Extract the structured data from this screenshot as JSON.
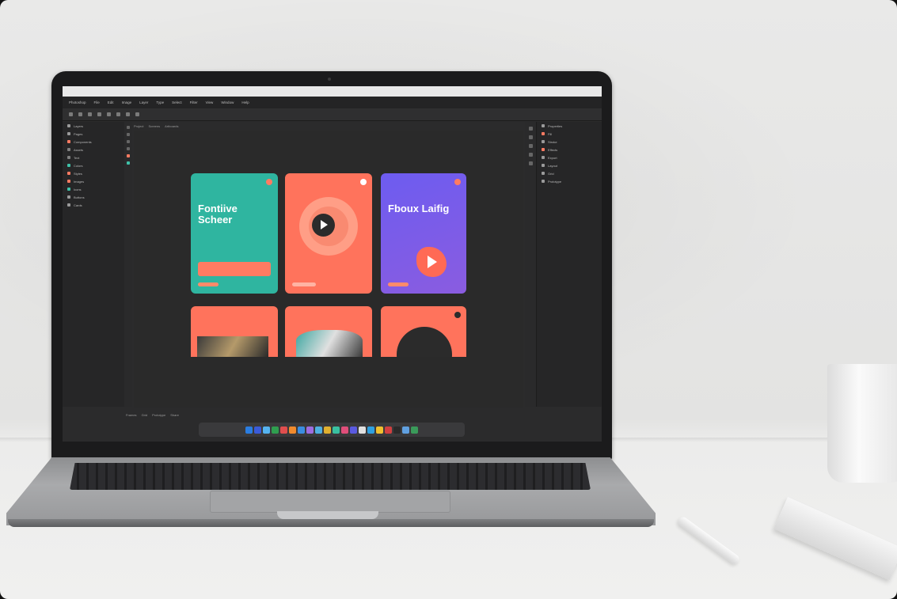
{
  "colors": {
    "teal": "#2fb5a0",
    "coral": "#ff735c",
    "purple": "#6d5cf0",
    "dark_ui": "#2b2b2c",
    "wall": "#e6e6e5"
  },
  "app": {
    "menu": [
      "Photoshop",
      "File",
      "Edit",
      "Image",
      "Layer",
      "Type",
      "Select",
      "Filter",
      "View",
      "Window",
      "Help"
    ],
    "breadcrumb": [
      "Project",
      "Screens",
      "Artboards"
    ],
    "status": [
      "Frames",
      "Grid",
      "Prototype",
      "Share"
    ]
  },
  "left_panel": {
    "items": [
      {
        "label": "Layers",
        "color": "#9a9a9a"
      },
      {
        "label": "Pages",
        "color": "#9a9a9a"
      },
      {
        "label": "Components",
        "color": "#ff7b62"
      },
      {
        "label": "Assets",
        "color": "#7f7f7f"
      },
      {
        "label": "Text",
        "color": "#7f7f7f"
      },
      {
        "label": "Colors",
        "color": "#3fc1a8"
      },
      {
        "label": "Styles",
        "color": "#ff7b62"
      },
      {
        "label": "Images",
        "color": "#ff7b62"
      },
      {
        "label": "Icons",
        "color": "#3fc1a8"
      },
      {
        "label": "Buttons",
        "color": "#9a9a9a"
      },
      {
        "label": "Cards",
        "color": "#9a9a9a"
      }
    ]
  },
  "right_panel": {
    "items": [
      {
        "label": "Properties",
        "color": "#9a9a9a"
      },
      {
        "label": "Fill",
        "color": "#ff7b62"
      },
      {
        "label": "Stroke",
        "color": "#9a9a9a"
      },
      {
        "label": "Effects",
        "color": "#ff7b62"
      },
      {
        "label": "Export",
        "color": "#9a9a9a"
      },
      {
        "label": "Layout",
        "color": "#9a9a9a"
      },
      {
        "label": "Grid",
        "color": "#9a9a9a"
      },
      {
        "label": "Prototype",
        "color": "#9a9a9a"
      }
    ]
  },
  "cards": [
    {
      "headline": "Fontiive Scheer",
      "variant": "teal"
    },
    {
      "headline": "",
      "variant": "coral-play"
    },
    {
      "headline": "Fboux Laifig",
      "variant": "purple"
    }
  ],
  "dock_colors": [
    "#2a7de1",
    "#3a5bd9",
    "#55b3f0",
    "#2f9e4f",
    "#e04e4e",
    "#f08a2d",
    "#3a8de0",
    "#9e6de0",
    "#4fb0e0",
    "#e0b02f",
    "#39c0a0",
    "#e04e7a",
    "#5a5ae0",
    "#e0e0e0",
    "#2fa0e0",
    "#f0c02f",
    "#d04040",
    "#2a2a2a",
    "#60a0e0",
    "#3a9a5a"
  ]
}
